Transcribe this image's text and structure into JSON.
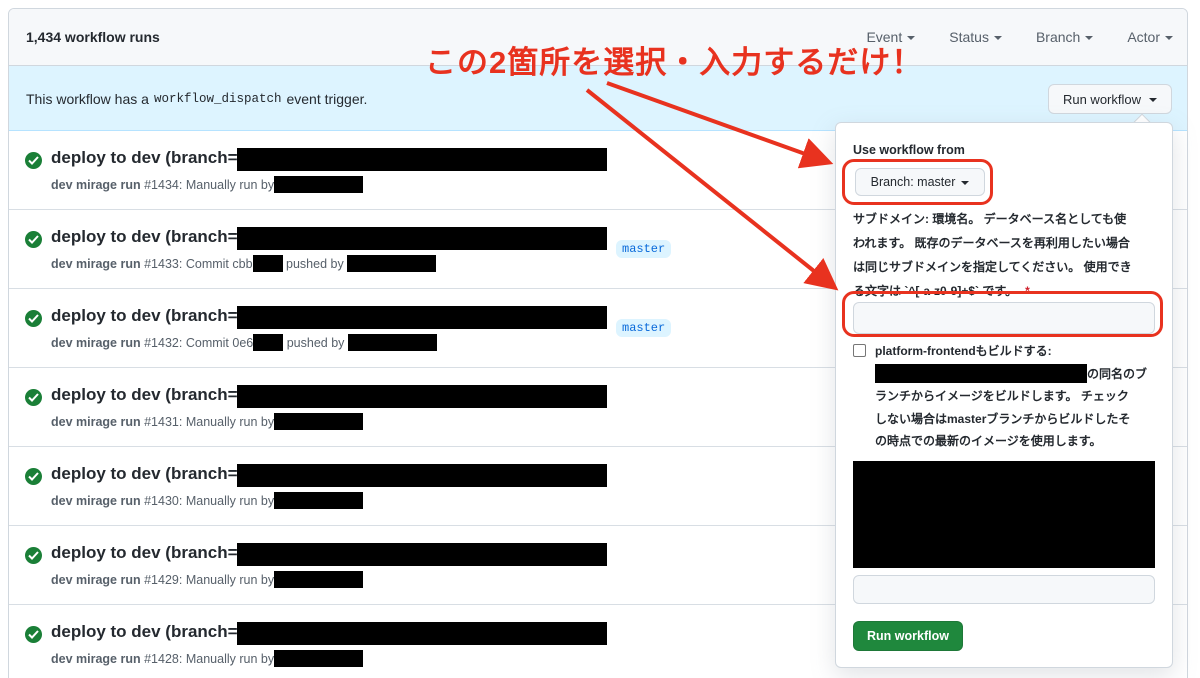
{
  "header": {
    "runs_count": "1,434 workflow runs",
    "filters": [
      "Event",
      "Status",
      "Branch",
      "Actor"
    ]
  },
  "banner": {
    "text_before": "This workflow has a",
    "code": "workflow_dispatch",
    "text_after": "event trigger.",
    "run_button": "Run workflow"
  },
  "runs": [
    {
      "title": "deploy to dev (branch=",
      "workflow": "dev mirage run",
      "number": "#1434",
      "trigger": "Manually run by",
      "pushed": "",
      "branch": ""
    },
    {
      "title": "deploy to dev (branch=",
      "workflow": "dev mirage run",
      "number": "#1433",
      "trigger": "Commit cbb",
      "pushed": "pushed by",
      "branch": "master"
    },
    {
      "title": "deploy to dev (branch=",
      "workflow": "dev mirage run",
      "number": "#1432",
      "trigger": "Commit 0e6",
      "pushed": "pushed by",
      "branch": "master"
    },
    {
      "title": "deploy to dev (branch=",
      "workflow": "dev mirage run",
      "number": "#1431",
      "trigger": "Manually run by",
      "pushed": "",
      "branch": ""
    },
    {
      "title": "deploy to dev (branch=",
      "workflow": "dev mirage run",
      "number": "#1430",
      "trigger": "Manually run by",
      "pushed": "",
      "branch": ""
    },
    {
      "title": "deploy to dev (branch=",
      "workflow": "dev mirage run",
      "number": "#1429",
      "trigger": "Manually run by",
      "pushed": "",
      "branch": ""
    },
    {
      "title": "deploy to dev (branch=",
      "workflow": "dev mirage run",
      "number": "#1428",
      "trigger": "Manually run by",
      "pushed": "",
      "branch": ""
    }
  ],
  "popup": {
    "use_from": "Use workflow from",
    "branch_button": "Branch: master",
    "desc_line1": "サブドメイン: 環境名。 データベース名としても使",
    "desc_line2": "われます。 既存のデータベースを再利用したい場合",
    "desc_line3": "は同じサブドメインを指定してください。 使用でき",
    "desc_line4": "る文字は `^[-a-z0-9]+$` です。",
    "required_mark": "*",
    "checkbox_line1": "platform-frontendもビルドする:",
    "checkbox_line2_after": "の同名のブ",
    "checkbox_line3": "ランチからイメージをビルドします。 チェック",
    "checkbox_line4": "しない場合はmasterブランチからビルドしたそ",
    "checkbox_line5": "の時点での最新のイメージを使用します。",
    "run_button": "Run workflow"
  },
  "annotation": {
    "text": "この2箇所を選択・入力するだけ！",
    "color": "#e8321f"
  },
  "colors": {
    "success": "#1a7f37",
    "primary_button": "#1f883d",
    "link_blue": "#0969da",
    "banner_bg": "#ddf4ff"
  }
}
